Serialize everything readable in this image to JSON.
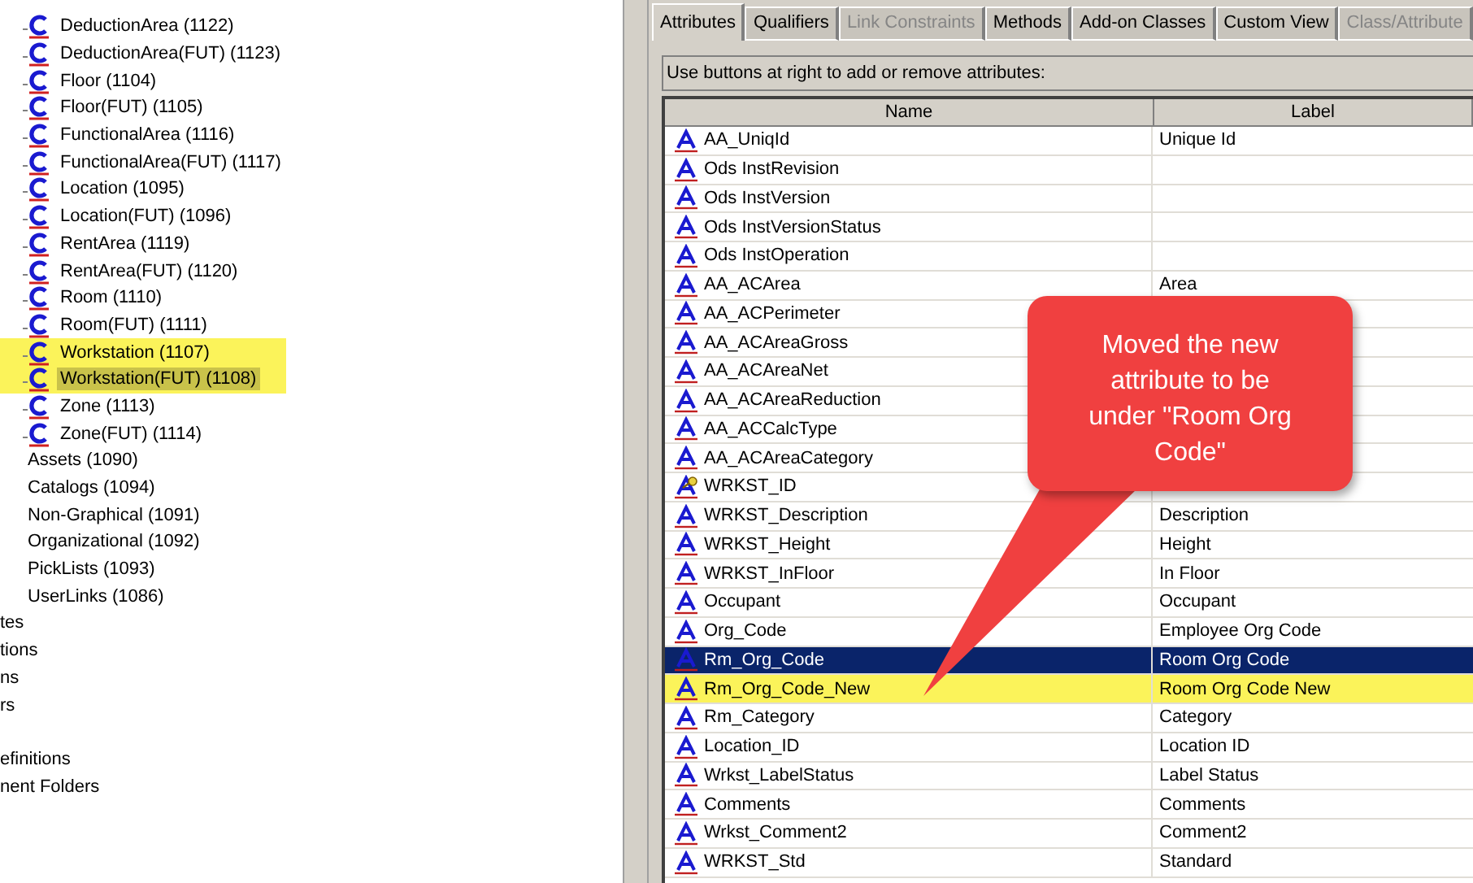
{
  "class_tree": {
    "classes": [
      {
        "label": "DeductionArea (1122)",
        "highlighted": false,
        "selected": false
      },
      {
        "label": "DeductionArea(FUT) (1123)",
        "highlighted": false,
        "selected": false
      },
      {
        "label": "Floor (1104)",
        "highlighted": false,
        "selected": false
      },
      {
        "label": "Floor(FUT) (1105)",
        "highlighted": false,
        "selected": false
      },
      {
        "label": "FunctionalArea (1116)",
        "highlighted": false,
        "selected": false
      },
      {
        "label": "FunctionalArea(FUT) (1117)",
        "highlighted": false,
        "selected": false
      },
      {
        "label": "Location (1095)",
        "highlighted": false,
        "selected": false
      },
      {
        "label": "Location(FUT) (1096)",
        "highlighted": false,
        "selected": false
      },
      {
        "label": "RentArea (1119)",
        "highlighted": false,
        "selected": false
      },
      {
        "label": "RentArea(FUT) (1120)",
        "highlighted": false,
        "selected": false
      },
      {
        "label": "Room (1110)",
        "highlighted": false,
        "selected": false
      },
      {
        "label": "Room(FUT) (1111)",
        "highlighted": false,
        "selected": false
      },
      {
        "label": "Workstation (1107)",
        "highlighted": true,
        "selected": false
      },
      {
        "label": "Workstation(FUT) (1108)",
        "highlighted": true,
        "selected": true
      },
      {
        "label": "Zone (1113)",
        "highlighted": false,
        "selected": false
      },
      {
        "label": "Zone(FUT) (1114)",
        "highlighted": false,
        "selected": false
      }
    ],
    "folders": [
      "Assets (1090)",
      "Catalogs (1094)",
      "Non-Graphical (1091)",
      "Organizational (1092)",
      "PickLists (1093)",
      "UserLinks (1086)"
    ],
    "cut_groups": [
      [
        "tes",
        "tions",
        "ns",
        "rs"
      ],
      [
        "efinitions",
        "nent Folders"
      ]
    ]
  },
  "tabs": [
    {
      "label": "Attributes",
      "selected": true,
      "disabled": false
    },
    {
      "label": "Qualifiers",
      "selected": false,
      "disabled": false
    },
    {
      "label": "Link Constraints",
      "selected": false,
      "disabled": true
    },
    {
      "label": "Methods",
      "selected": false,
      "disabled": false
    },
    {
      "label": "Add-on Classes",
      "selected": false,
      "disabled": false
    },
    {
      "label": "Custom View",
      "selected": false,
      "disabled": false
    },
    {
      "label": "Class/Attribute",
      "selected": false,
      "disabled": true
    }
  ],
  "hint": "Use buttons at right to add or remove attributes:",
  "table": {
    "columns": [
      "Name",
      "Label"
    ],
    "rows": [
      {
        "kind": "attribute",
        "name": "AA_UniqId",
        "label": "Unique Id",
        "selected": false,
        "highlighted": false
      },
      {
        "kind": "attribute",
        "name": "Ods InstRevision",
        "label": "",
        "selected": false,
        "highlighted": false
      },
      {
        "kind": "attribute",
        "name": "Ods InstVersion",
        "label": "",
        "selected": false,
        "highlighted": false
      },
      {
        "kind": "attribute",
        "name": "Ods InstVersionStatus",
        "label": "",
        "selected": false,
        "highlighted": false
      },
      {
        "kind": "attribute",
        "name": "Ods InstOperation",
        "label": "",
        "selected": false,
        "highlighted": false
      },
      {
        "kind": "attribute",
        "name": "AA_ACArea",
        "label": "Area",
        "selected": false,
        "highlighted": false
      },
      {
        "kind": "attribute",
        "name": "AA_ACPerimeter",
        "label": "",
        "selected": false,
        "highlighted": false
      },
      {
        "kind": "attribute",
        "name": "AA_ACAreaGross",
        "label": "",
        "selected": false,
        "highlighted": false
      },
      {
        "kind": "attribute",
        "name": "AA_ACAreaNet",
        "label": "",
        "selected": false,
        "highlighted": false
      },
      {
        "kind": "attribute",
        "name": "AA_ACAreaReduction",
        "label": "",
        "selected": false,
        "highlighted": false
      },
      {
        "kind": "attribute",
        "name": "AA_ACCalcType",
        "label": "",
        "selected": false,
        "highlighted": false
      },
      {
        "kind": "attribute",
        "name": "AA_ACAreaCategory",
        "label": "",
        "selected": false,
        "highlighted": false
      },
      {
        "kind": "key",
        "name": "WRKST_ID",
        "label": "",
        "selected": false,
        "highlighted": false
      },
      {
        "kind": "attribute",
        "name": "WRKST_Description",
        "label": "Description",
        "selected": false,
        "highlighted": false
      },
      {
        "kind": "attribute",
        "name": "WRKST_Height",
        "label": "Height",
        "selected": false,
        "highlighted": false
      },
      {
        "kind": "attribute",
        "name": "WRKST_InFloor",
        "label": "In Floor",
        "selected": false,
        "highlighted": false
      },
      {
        "kind": "attribute",
        "name": "Occupant",
        "label": "Occupant",
        "selected": false,
        "highlighted": false
      },
      {
        "kind": "attribute",
        "name": "Org_Code",
        "label": "Employee Org Code",
        "selected": false,
        "highlighted": false
      },
      {
        "kind": "attribute",
        "name": "Rm_Org_Code",
        "label": "Room Org Code",
        "selected": true,
        "highlighted": false
      },
      {
        "kind": "attribute",
        "name": "Rm_Org_Code_New",
        "label": "Room Org Code New",
        "selected": false,
        "highlighted": true
      },
      {
        "kind": "attribute",
        "name": "Rm_Category",
        "label": "Category",
        "selected": false,
        "highlighted": false
      },
      {
        "kind": "attribute",
        "name": "Location_ID",
        "label": "Location ID",
        "selected": false,
        "highlighted": false
      },
      {
        "kind": "attribute",
        "name": "Wrkst_LabelStatus",
        "label": "Label Status",
        "selected": false,
        "highlighted": false
      },
      {
        "kind": "attribute",
        "name": "Comments",
        "label": "Comments",
        "selected": false,
        "highlighted": false
      },
      {
        "kind": "attribute",
        "name": "Wrkst_Comment2",
        "label": "Comment2",
        "selected": false,
        "highlighted": false
      },
      {
        "kind": "attribute",
        "name": "WRKST_Std",
        "label": "Standard",
        "selected": false,
        "highlighted": false
      }
    ]
  },
  "callout": {
    "text": "Moved the new attribute to be under \"Room Org Code\""
  }
}
